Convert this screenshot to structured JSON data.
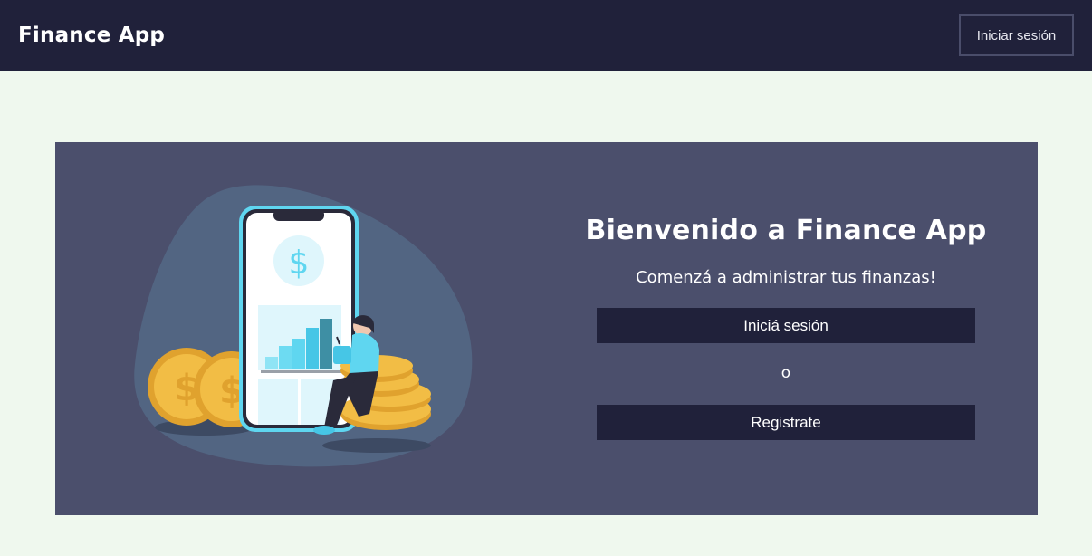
{
  "navbar": {
    "brand": "Finance App",
    "login_label": "Iniciar sesión"
  },
  "hero": {
    "title": "Bienvenido a Finance App",
    "subtitle": "Comenzá a administrar tus finanzas!",
    "login_button": "Iniciá sesión",
    "or_text": "o",
    "register_button": "Registrate",
    "illustration_icon": "dollar-sign-icon"
  },
  "colors": {
    "navbar_bg": "#20213a",
    "page_bg": "#eff8ee",
    "hero_bg": "#4b4f6c",
    "button_bg": "#20213a",
    "accent": "#5fd6f0",
    "coin": "#f2bd45"
  }
}
